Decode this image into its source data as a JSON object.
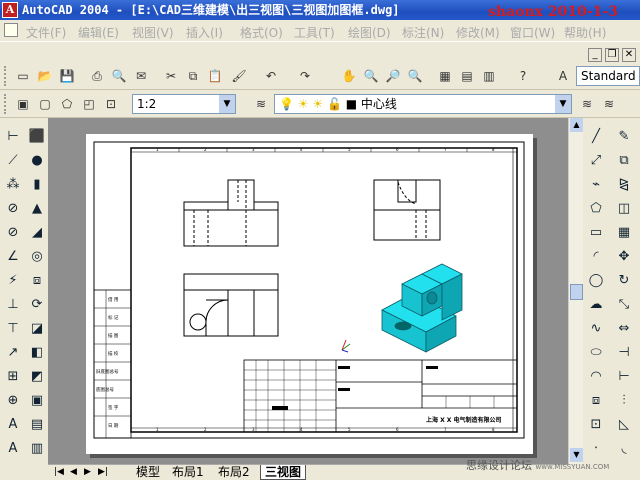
{
  "titlebar": {
    "title": "AutoCAD 2004 - [E:\\CAD三维建模\\出三视图\\三视图加图框.dwg]",
    "watermark": "shaonx 2010-1-3"
  },
  "menu": [
    "文件(F)",
    "编辑(E)",
    "视图(V)",
    "插入(I)",
    "格式(O)",
    "工具(T)",
    "绘图(D)",
    "标注(N)",
    "修改(M)",
    "窗口(W)",
    "帮助(H)"
  ],
  "toolbar1": {
    "textstyle_value": "Standard"
  },
  "toolbar2": {
    "scale_value": "1:2",
    "layer_value": "中心线"
  },
  "tabs": {
    "items": [
      "模型",
      "布局1",
      "布局2",
      "三视图"
    ],
    "active": "三视图"
  },
  "site_watermark": "思缘设计论坛",
  "site_url": "www.MISSYUAN.COM",
  "drawing": {
    "company": "上海 X X 电气制造有限公司",
    "side_labels": [
      "借 用",
      "标 记",
      "描 图",
      "描 校",
      "旧底图总号",
      "底图总号",
      "签 字",
      "日 期"
    ],
    "column_numbers": [
      "1",
      "2",
      "3",
      "4",
      "5",
      "6",
      "7",
      "8",
      "1",
      "2",
      "3",
      "4",
      "5",
      "6",
      "7",
      "8"
    ]
  },
  "colors": {
    "title_active": "#1f4fbf",
    "watermark": "#d81b1b",
    "model_3d": "#1fd6e3",
    "canvas_bg": "#8e8e8e"
  }
}
